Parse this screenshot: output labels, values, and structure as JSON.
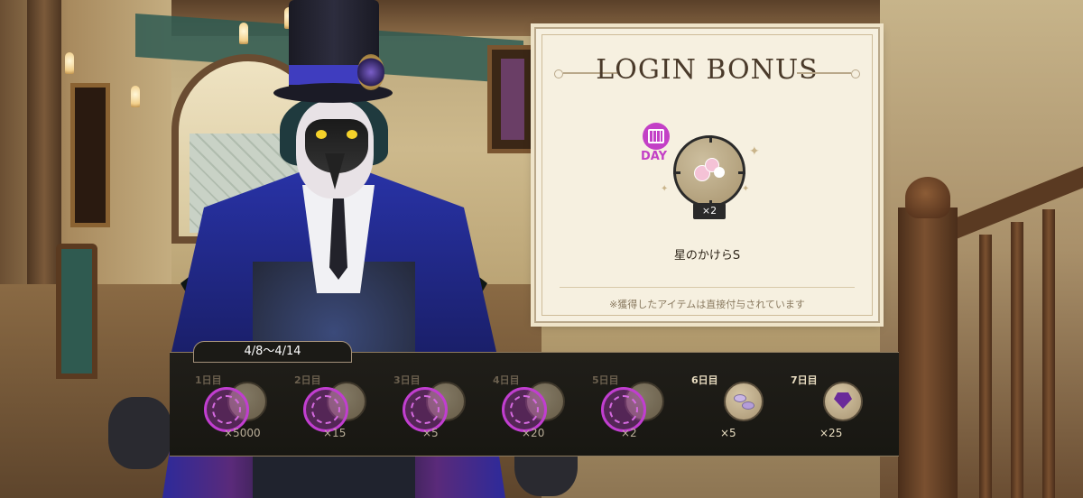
{
  "login_bonus": {
    "title": "LOGIN BONUS",
    "today": {
      "badge_icon": "calendar-icon",
      "badge_label": "DAY",
      "item_name": "星のかけらS",
      "quantity": "×2"
    },
    "note": "※獲得したアイテムは直接付与されています"
  },
  "period": "4/8〜4/14",
  "days": [
    {
      "label": "1日目",
      "quantity": "×5000",
      "received": true,
      "item_icon": "coin-icon"
    },
    {
      "label": "2日目",
      "quantity": "×15",
      "received": true,
      "item_icon": "gem-icon"
    },
    {
      "label": "3日目",
      "quantity": "×5",
      "received": true,
      "item_icon": "cupcake-icon"
    },
    {
      "label": "4日目",
      "quantity": "×20",
      "received": true,
      "item_icon": "gem-icon"
    },
    {
      "label": "5日目",
      "quantity": "×2",
      "received": true,
      "item_icon": "star-fragment-icon"
    },
    {
      "label": "6日目",
      "quantity": "×5",
      "received": false,
      "item_icon": "macaron-icon"
    },
    {
      "label": "7日目",
      "quantity": "×25",
      "received": false,
      "item_icon": "purple-gem-icon"
    }
  ],
  "colors": {
    "accent": "#c340c6",
    "strip_bg": "#1b1a16",
    "card_bg": "#f6f0e0"
  }
}
